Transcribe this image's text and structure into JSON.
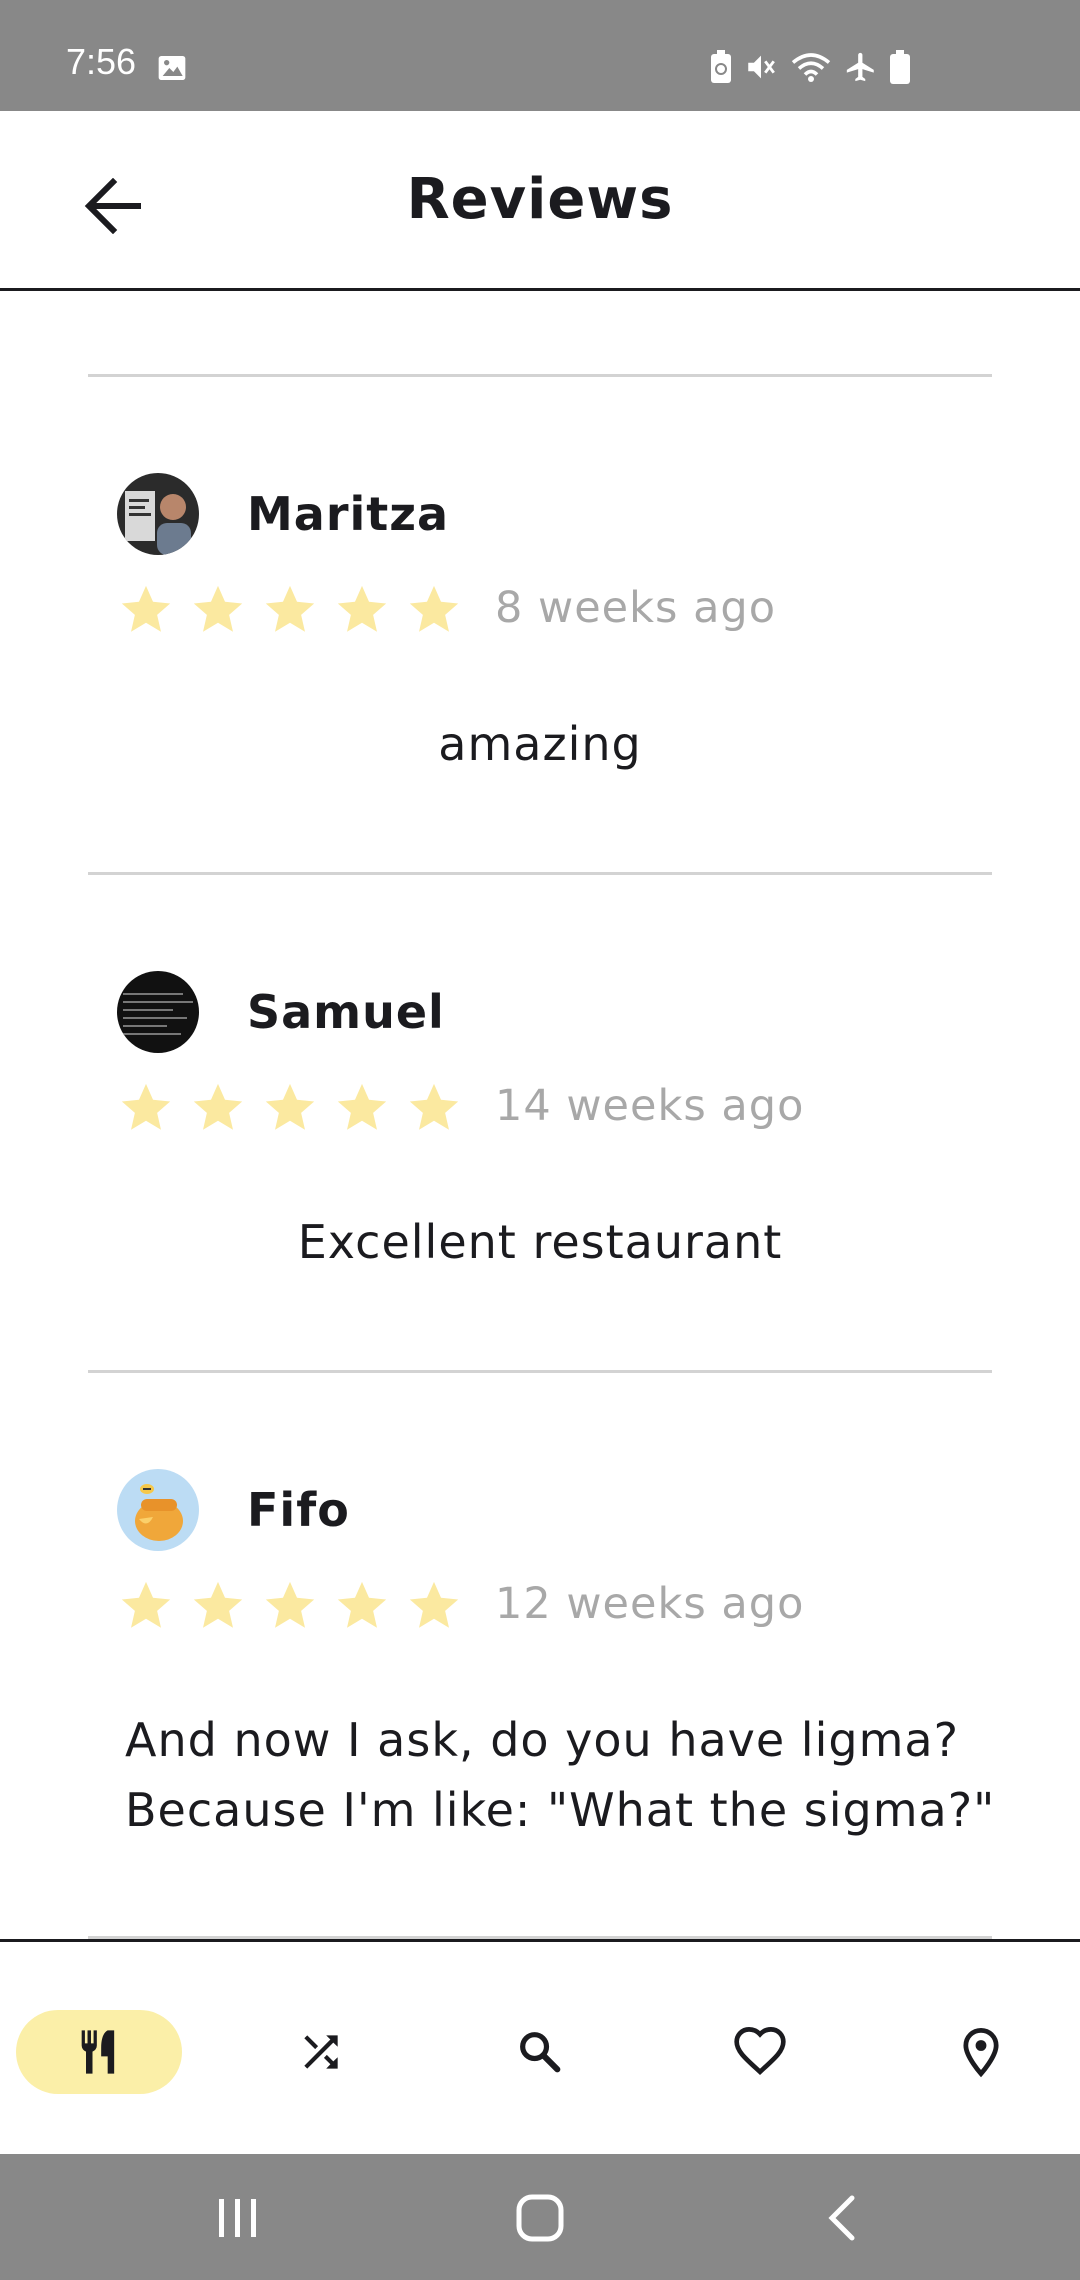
{
  "status_bar": {
    "time": "7:56",
    "icons": [
      "image-icon",
      "battery-saver-icon",
      "mute-icon",
      "wifi-icon",
      "airplane-icon",
      "battery-icon"
    ]
  },
  "app_bar": {
    "title": "Reviews",
    "back_icon": "arrow-back-icon"
  },
  "reviews": [
    {
      "name": "Maritza",
      "avatar": "photo-avatar",
      "rating": 5,
      "time": "8 weeks ago",
      "text": "amazing"
    },
    {
      "name": "Samuel",
      "avatar": "dark-avatar",
      "rating": 5,
      "time": "14 weeks ago",
      "text": "Excellent restaurant"
    },
    {
      "name": "Fifo",
      "avatar": "honey-pot-avatar",
      "rating": 5,
      "time": "12 weeks ago",
      "text_line1": "And now I ask, do you have ligma?",
      "text_line2": "Because I'm like: \"What the sigma?\""
    }
  ],
  "bottom_nav": {
    "items": [
      {
        "icon": "restaurant-icon",
        "active": true
      },
      {
        "icon": "shuffle-icon",
        "active": false
      },
      {
        "icon": "search-icon",
        "active": false
      },
      {
        "icon": "heart-icon",
        "active": false
      },
      {
        "icon": "location-pin-icon",
        "active": false
      }
    ]
  },
  "colors": {
    "star": "#fbe9a0",
    "active_nav": "#fbefa8",
    "system_bar": "#888888",
    "divider": "#d3d3d3",
    "muted_text": "#a8a8a8"
  }
}
